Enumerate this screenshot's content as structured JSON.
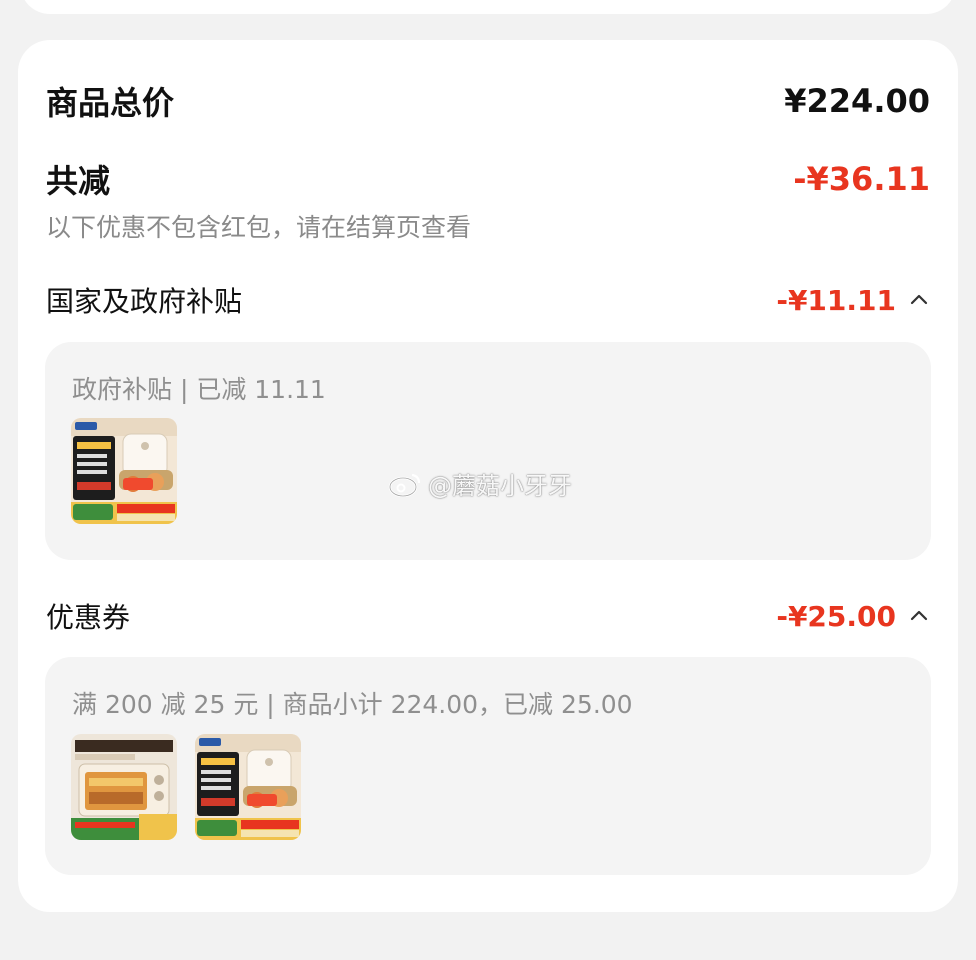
{
  "summary": {
    "total_label": "商品总价",
    "total_value": "¥224.00",
    "discount_label": "共减",
    "discount_value": "-¥36.11",
    "note": "以下优惠不包含红包，请在结算页查看"
  },
  "sections": [
    {
      "title": "国家及政府补贴",
      "amount": "-¥11.11",
      "detail": "政府补贴 | 已减 11.11",
      "products": [
        "air-fryer"
      ]
    },
    {
      "title": "优惠券",
      "amount": "-¥25.00",
      "detail": "满 200 减 25 元 | 商品小计 224.00，已减 25.00",
      "products": [
        "oven",
        "air-fryer"
      ]
    }
  ],
  "watermark": "@蘑菇小牙牙",
  "colors": {
    "accent_red": "#e8351f",
    "muted_text": "#8a8a8a"
  }
}
